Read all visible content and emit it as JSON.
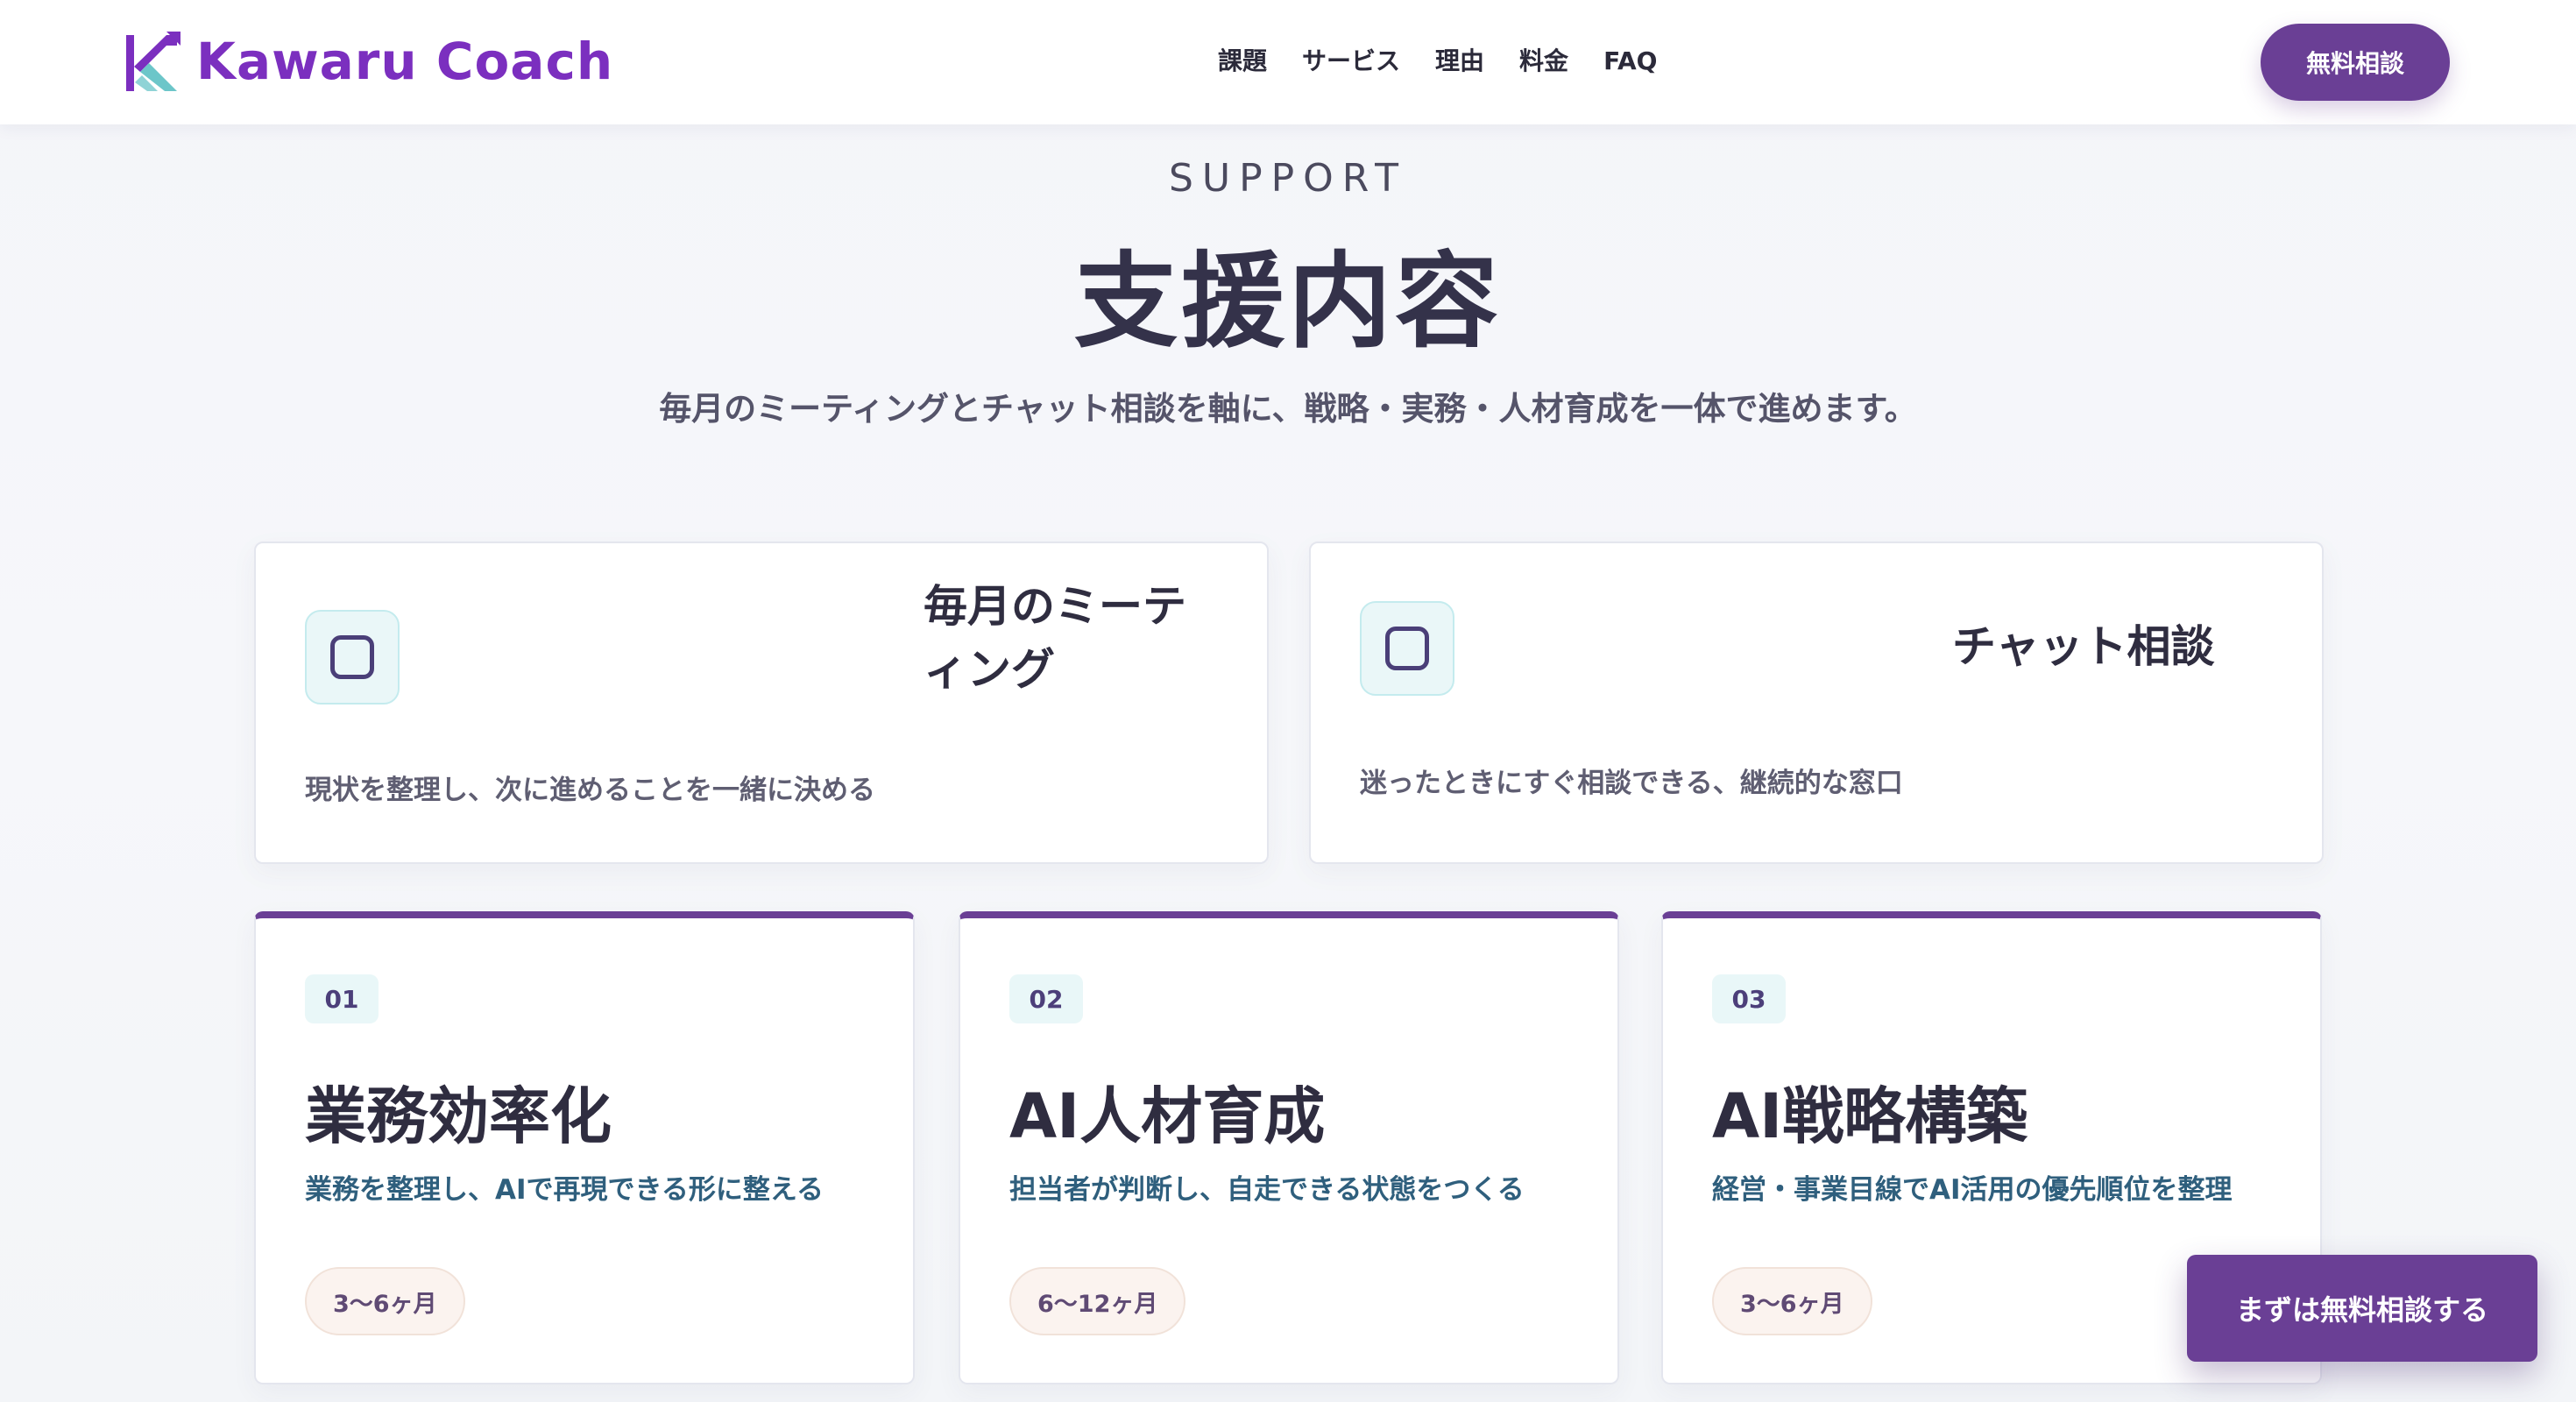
{
  "brand": {
    "name": "Kawaru Coach",
    "accent": "#7b2fbf",
    "primary": "#6a3f95"
  },
  "nav": {
    "items": [
      "課題",
      "サービス",
      "理由",
      "料金",
      "FAQ"
    ]
  },
  "header": {
    "cta": "無料相談"
  },
  "section": {
    "eyebrow": "SUPPORT",
    "title": "支援内容",
    "lead": "毎月のミーティングとチャット相談を軸に、戦略・実務・人材育成を一体で進めます。"
  },
  "top_cards": [
    {
      "icon": "square-icon",
      "title_line1": "毎月のミーテ",
      "title_line2": "ィング",
      "desc": "現状を整理し、次に進めることを一緒に決める"
    },
    {
      "icon": "square-icon",
      "title": "チャット相談",
      "desc": "迷ったときにすぐ相談できる、継続的な窓口"
    }
  ],
  "plans": [
    {
      "num": "01",
      "title": "業務効率化",
      "desc": "業務を整理し、AIで再現できる形に整える",
      "period": "3〜6ヶ月"
    },
    {
      "num": "02",
      "title": "AI人材育成",
      "desc": "担当者が判断し、自走できる状態をつくる",
      "period": "6〜12ヶ月"
    },
    {
      "num": "03",
      "title": "AI戦略構築",
      "desc": "経営・事業目線でAI活用の優先順位を整理",
      "period": "3〜6ヶ月"
    }
  ],
  "floating_cta": "まずは無料相談する"
}
